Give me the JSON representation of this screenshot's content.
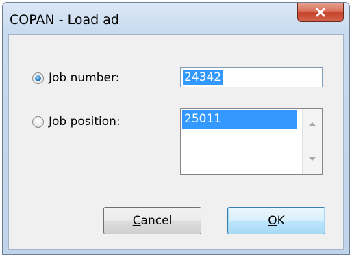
{
  "window": {
    "title": "COPAN - Load ad"
  },
  "icons": {
    "close": "close-icon",
    "scroll_up": "scroll-up-arrow-icon",
    "scroll_down": "scroll-down-arrow-icon"
  },
  "form": {
    "job_number": {
      "label": "Job number:",
      "value": "24342",
      "selected": true
    },
    "job_position": {
      "label": "Job position:",
      "selected": false,
      "items": [
        "25011"
      ],
      "selected_item": "25011"
    }
  },
  "buttons": {
    "cancel": {
      "mnemonic": "C",
      "rest": "ancel"
    },
    "ok": {
      "mnemonic": "O",
      "rest": "K"
    }
  },
  "colors": {
    "selection": "#3399ff",
    "close_button": "#c4432b",
    "default_button": "#a7d9f5"
  }
}
